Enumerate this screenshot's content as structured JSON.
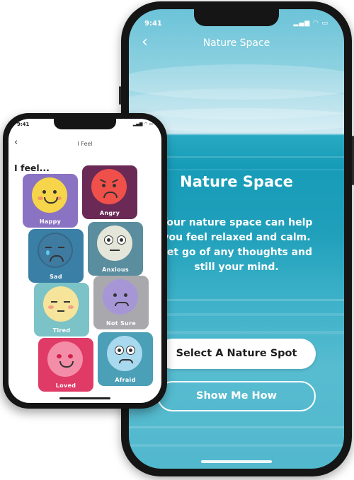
{
  "main_phone": {
    "status_time": "9:41",
    "status_icons": "▂▄▆ ◠ ▭",
    "nav_back": "‹",
    "nav_title": "Nature Space",
    "heading": "Nature Space",
    "body": "Your nature space can help you feel relaxed and calm. Let go of any thoughts and still your mind.",
    "primary_button": "Select A Nature Spot",
    "secondary_button": "Show Me How"
  },
  "feel_phone": {
    "status_time": "9:41",
    "status_icons": "▂▄▆ ◠ ▭",
    "nav_back": "‹",
    "nav_title": "I Feel",
    "heading": "I feel...",
    "moods": [
      {
        "label": "Happy",
        "icon": "happy-face-icon",
        "bg": "#8b73c3",
        "face": "#f6d54a"
      },
      {
        "label": "Angry",
        "icon": "angry-face-icon",
        "bg": "#6a2a55",
        "face": "#f0504a"
      },
      {
        "label": "Sad",
        "icon": "sad-face-icon",
        "bg": "#3a7fa6",
        "face": "#3f7aa0"
      },
      {
        "label": "Anxious",
        "icon": "anxious-face-icon",
        "bg": "#5a8e9e",
        "face": "#e4e6da"
      },
      {
        "label": "Tired",
        "icon": "tired-face-icon",
        "bg": "#7cc3c8",
        "face": "#f5e49a"
      },
      {
        "label": "Not Sure",
        "icon": "unsure-face-icon",
        "bg": "#a9a9ad",
        "face": "#a796d6"
      },
      {
        "label": "Loved",
        "icon": "loved-face-icon",
        "bg": "#e03a66",
        "face": "#f48da8"
      },
      {
        "label": "Afraid",
        "icon": "afraid-face-icon",
        "bg": "#4b9fb6",
        "face": "#a9d9ef"
      }
    ]
  }
}
